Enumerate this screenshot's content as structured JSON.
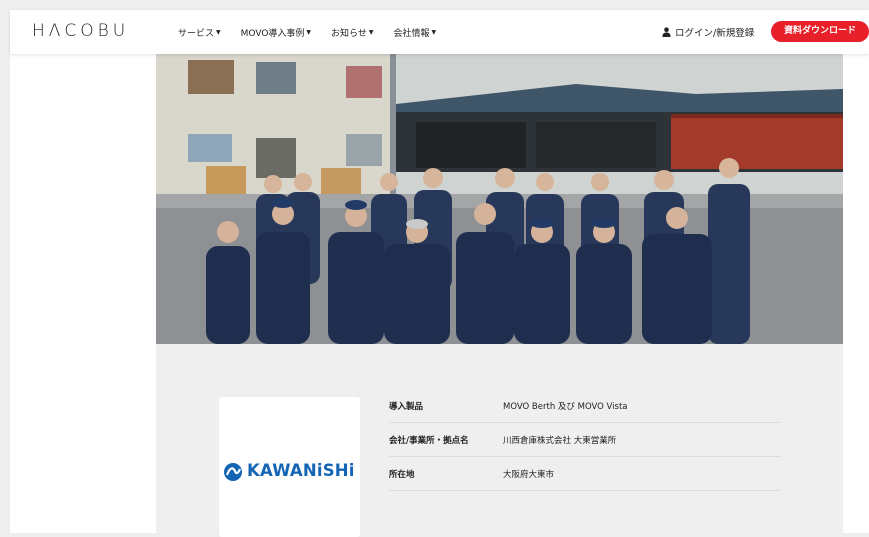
{
  "header": {
    "logo": "HΛCOBU",
    "nav": [
      {
        "label": "サービス",
        "caret": "▼"
      },
      {
        "label": "MOVO導入事例",
        "caret": "▼"
      },
      {
        "label": "お知らせ",
        "caret": "▼"
      },
      {
        "label": "会社情報",
        "caret": "▼"
      }
    ],
    "login_label": "ログイン/新規登録",
    "download_label": "資料ダウンロード",
    "accent_color": "#e8202a"
  },
  "case": {
    "company_logo_text": "KAWANiSHi",
    "rows": [
      {
        "label": "導入製品",
        "value": "MOVO Berth 及び MOVO Vista"
      },
      {
        "label": "会社/事業所・拠点名",
        "value": "川西倉庫株式会社 大東営業所"
      },
      {
        "label": "所在地",
        "value": "大阪府大東市"
      }
    ],
    "brand_color": "#1565b5"
  },
  "icons": {
    "user": "user-icon",
    "caret": "chevron-down-icon"
  }
}
